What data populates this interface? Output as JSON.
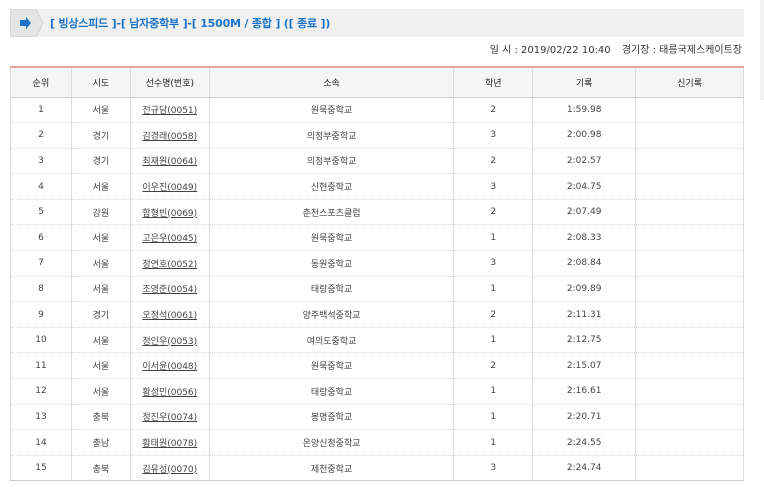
{
  "header": {
    "title": "[ 빙상스피드 ]-[ 남자중학부 ]-[ 1500M / 종합 ] ([ 종료 ])"
  },
  "meta": {
    "datetime": "일 시 : 2019/02/22 10:40",
    "venue": "경기장 : 태릉국제스케이트장"
  },
  "table": {
    "columns": [
      "순위",
      "시도",
      "선수명(번호)",
      "소속",
      "학년",
      "기록",
      "신기록"
    ],
    "rows": [
      {
        "rank": "1",
        "region": "서울",
        "name": "전규담(0051)",
        "team": "원묵중학교",
        "grade": "2",
        "record": "1:59.98",
        "new": ""
      },
      {
        "rank": "2",
        "region": "경기",
        "name": "김경래(0058)",
        "team": "의정부중학교",
        "grade": "3",
        "record": "2:00.98",
        "new": ""
      },
      {
        "rank": "3",
        "region": "경기",
        "name": "최재원(0064)",
        "team": "의정부중학교",
        "grade": "2",
        "record": "2:02.57",
        "new": ""
      },
      {
        "rank": "4",
        "region": "서울",
        "name": "이우진(0049)",
        "team": "신현중학교",
        "grade": "3",
        "record": "2:04.75",
        "new": ""
      },
      {
        "rank": "5",
        "region": "강원",
        "name": "함형빈(0069)",
        "team": "춘천스포츠클럽",
        "grade": "2",
        "record": "2:07.49",
        "new": ""
      },
      {
        "rank": "6",
        "region": "서울",
        "name": "고은우(0045)",
        "team": "원묵중학교",
        "grade": "1",
        "record": "2:08.33",
        "new": ""
      },
      {
        "rank": "7",
        "region": "서울",
        "name": "정연호(0052)",
        "team": "동원중학교",
        "grade": "3",
        "record": "2:08.84",
        "new": ""
      },
      {
        "rank": "8",
        "region": "서울",
        "name": "조영준(0054)",
        "team": "태랑중학교",
        "grade": "1",
        "record": "2:09.89",
        "new": ""
      },
      {
        "rank": "9",
        "region": "경기",
        "name": "오정석(0061)",
        "team": "양주백석중학교",
        "grade": "2",
        "record": "2:11.31",
        "new": ""
      },
      {
        "rank": "10",
        "region": "서울",
        "name": "정인우(0053)",
        "team": "여의도중학교",
        "grade": "1",
        "record": "2:12.75",
        "new": ""
      },
      {
        "rank": "11",
        "region": "서울",
        "name": "이서윤(0048)",
        "team": "원묵중학교",
        "grade": "2",
        "record": "2:15.07",
        "new": ""
      },
      {
        "rank": "12",
        "region": "서울",
        "name": "황성민(0056)",
        "team": "태랑중학교",
        "grade": "1",
        "record": "2:16.61",
        "new": ""
      },
      {
        "rank": "13",
        "region": "충북",
        "name": "정진우(0074)",
        "team": "봉명중학교",
        "grade": "1",
        "record": "2:20.71",
        "new": ""
      },
      {
        "rank": "14",
        "region": "충남",
        "name": "황태원(0078)",
        "team": "온양신정중학교",
        "grade": "1",
        "record": "2:24.55",
        "new": ""
      },
      {
        "rank": "15",
        "region": "충북",
        "name": "김유성(0070)",
        "team": "제천중학교",
        "grade": "3",
        "record": "2:24.74",
        "new": ""
      }
    ]
  },
  "colors": {
    "accent": "#1a73c7",
    "header_border": "#e6a0a0"
  },
  "icons": {
    "tab_arrow": "arrow-right-icon"
  }
}
